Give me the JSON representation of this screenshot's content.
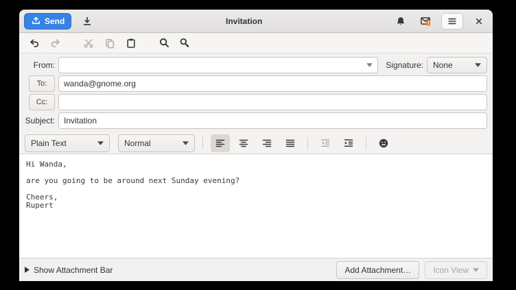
{
  "window": {
    "title": "Invitation"
  },
  "headerbar": {
    "send_label": "Send"
  },
  "fields": {
    "from_label": "From:",
    "signature_label": "Signature:",
    "signature_value": "None",
    "to_label": "To:",
    "to_value": "wanda@gnome.org",
    "cc_label": "Cc:",
    "cc_value": "",
    "subject_label": "Subject:",
    "subject_value": "Invitation"
  },
  "format_bar": {
    "mode_value": "Plain Text",
    "style_value": "Normal"
  },
  "body": {
    "text": "Hi Wanda,\n\nare you going to be around next Sunday evening?\n\nCheers,\nRupert"
  },
  "footer": {
    "show_attachment_bar": "Show Attachment Bar",
    "add_attachment_label": "Add Attachment…",
    "icon_view_label": "Icon View"
  },
  "colors": {
    "accent": "#3584e4",
    "badge": "#ff7800"
  }
}
